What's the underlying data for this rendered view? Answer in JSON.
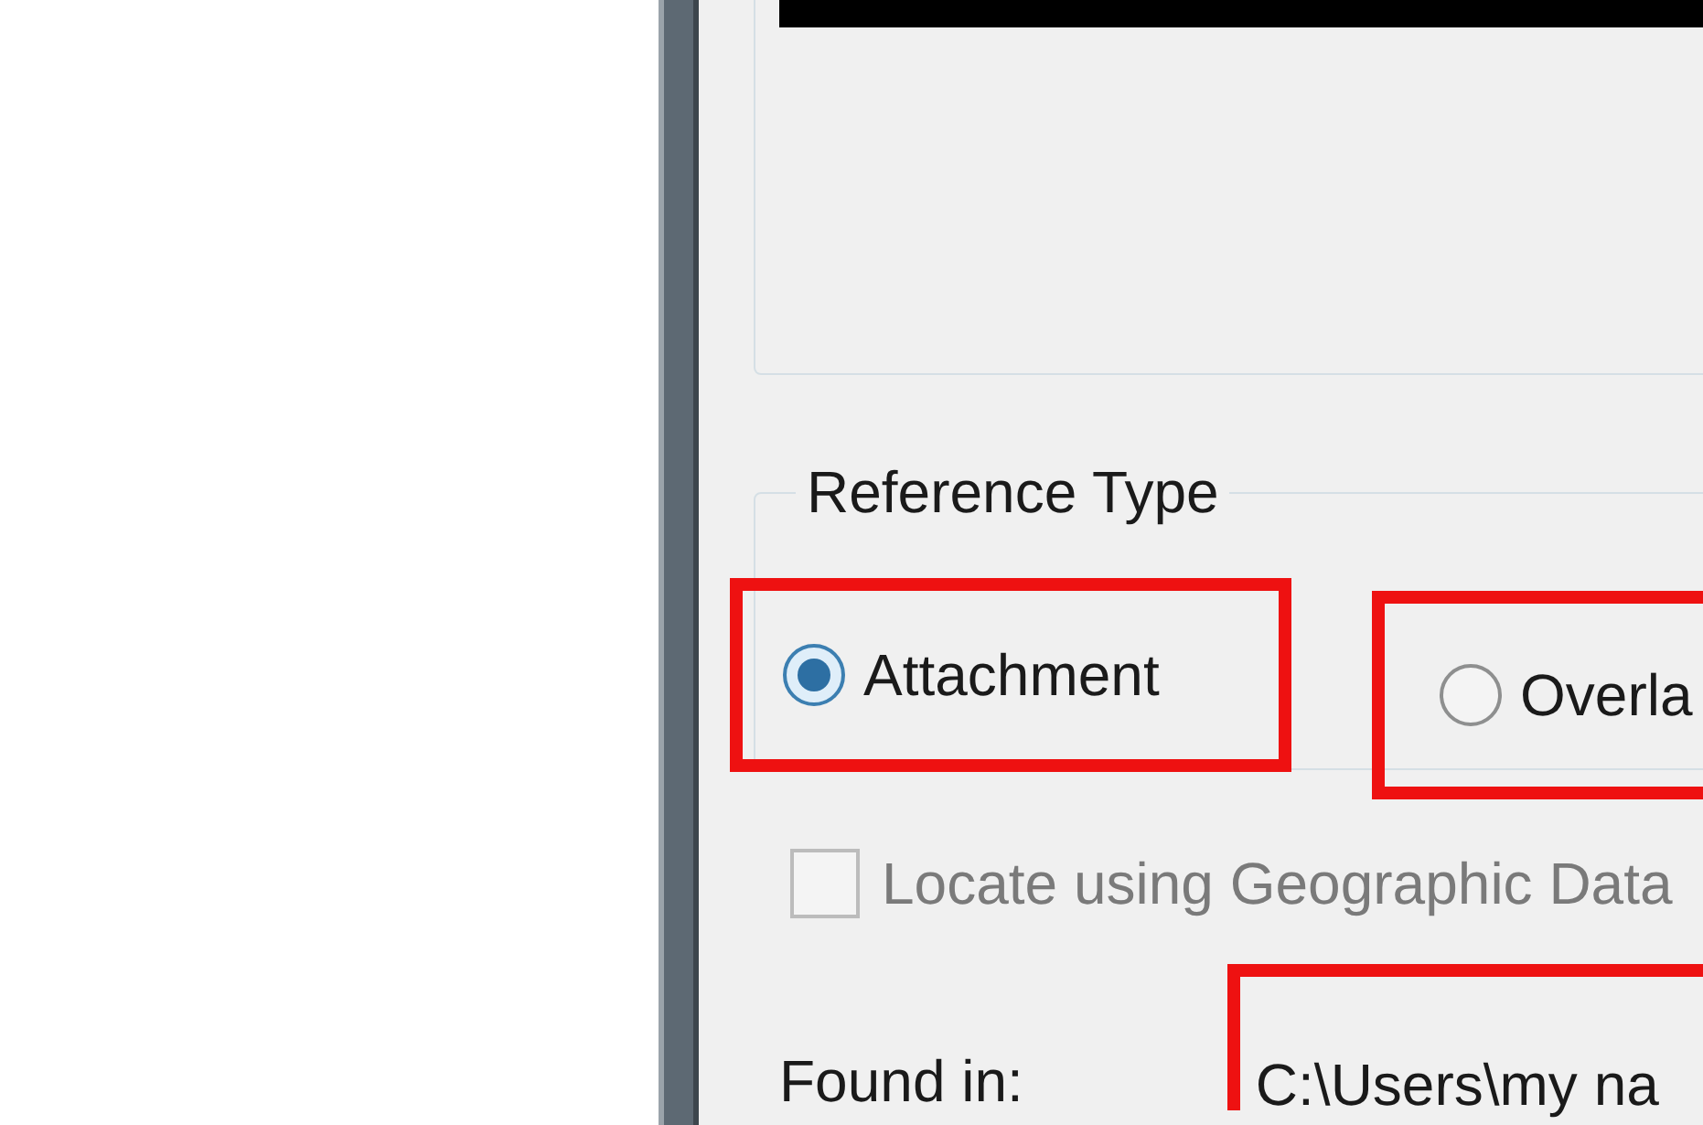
{
  "reference_type": {
    "title": "Reference Type",
    "options": [
      {
        "label": "Attachment",
        "selected": true,
        "highlighted": true
      },
      {
        "label": "Overla",
        "selected": false,
        "highlighted": true
      }
    ]
  },
  "geographic_checkbox": {
    "label": "Locate using Geographic Data",
    "checked": false,
    "disabled": true
  },
  "found_in": {
    "label": "Found in:",
    "value": "C:\\Users\\my na",
    "highlighted": true
  }
}
